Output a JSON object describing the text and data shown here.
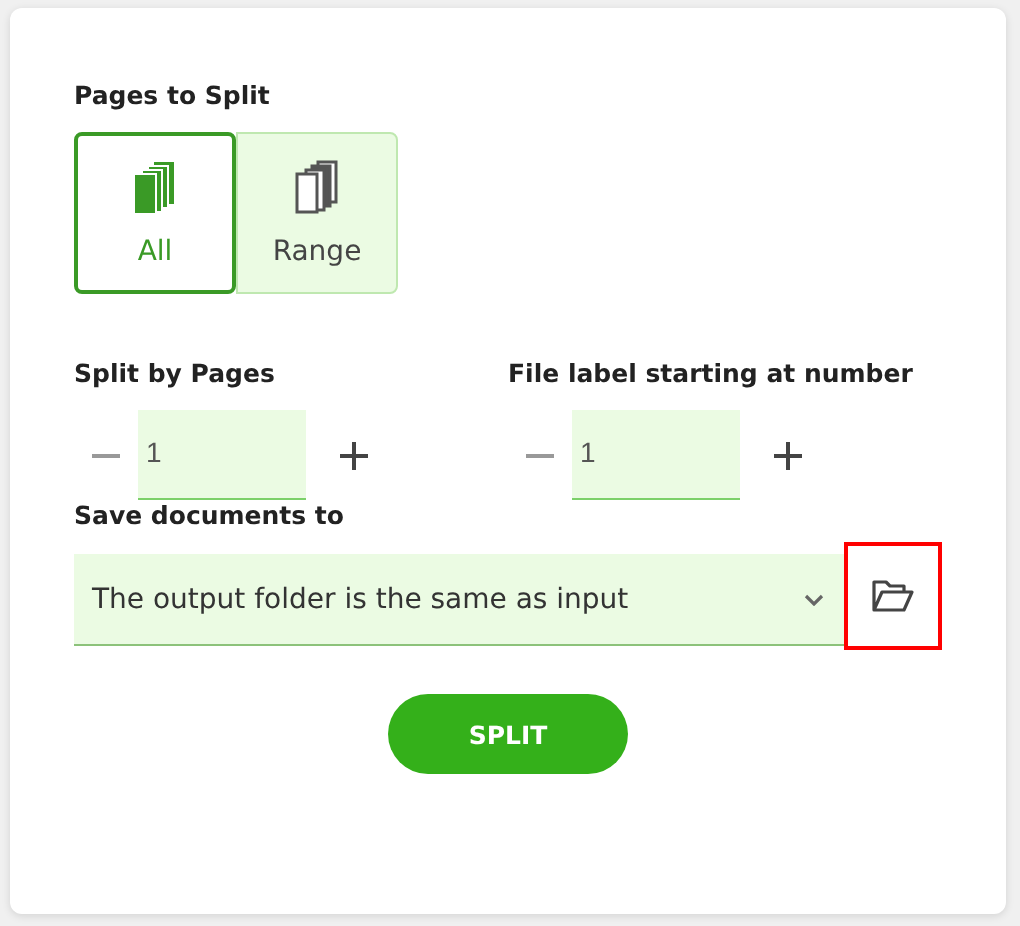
{
  "pages_to_split": {
    "label": "Pages to Split",
    "options": [
      {
        "label": "All",
        "kind": "all",
        "selected": true
      },
      {
        "label": "Range",
        "kind": "range",
        "selected": false
      }
    ]
  },
  "steppers": [
    {
      "label": "Split by Pages",
      "value": "1"
    },
    {
      "label": "File label starting at number",
      "value": "1"
    }
  ],
  "save_to": {
    "label": "Save documents to",
    "value": "The output folder is the same as input",
    "folder_button_highlighted": true
  },
  "split_button": "SPLIT"
}
